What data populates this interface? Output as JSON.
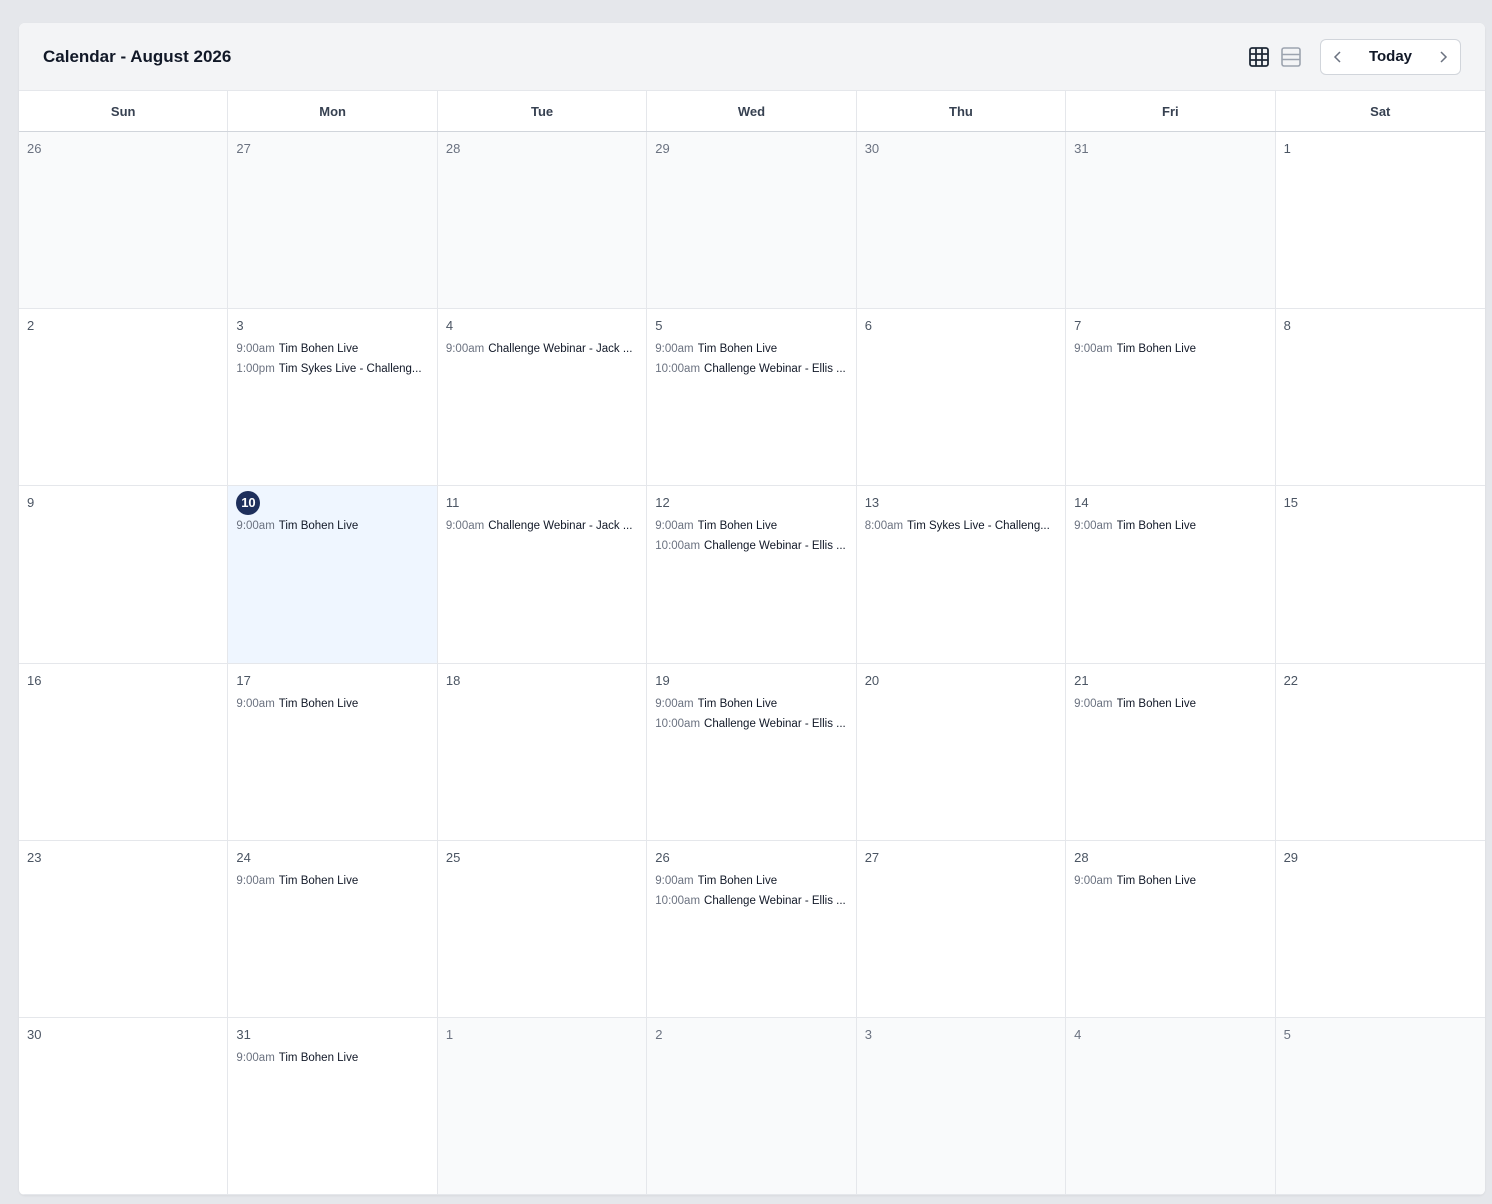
{
  "header": {
    "title": "Calendar - August 2026",
    "today_label": "Today",
    "views": [
      {
        "name": "month-grid-icon",
        "active": true
      },
      {
        "name": "list-view-icon",
        "active": false
      }
    ]
  },
  "colors": {
    "today_badge": "#1e2f5c",
    "today_bg": "#eff6ff",
    "outside_bg": "#f9fafb"
  },
  "weekdays": [
    "Sun",
    "Mon",
    "Tue",
    "Wed",
    "Thu",
    "Fri",
    "Sat"
  ],
  "days": [
    {
      "day": "26",
      "outside": true,
      "events": []
    },
    {
      "day": "27",
      "outside": true,
      "events": []
    },
    {
      "day": "28",
      "outside": true,
      "events": []
    },
    {
      "day": "29",
      "outside": true,
      "events": []
    },
    {
      "day": "30",
      "outside": true,
      "events": []
    },
    {
      "day": "31",
      "outside": true,
      "events": []
    },
    {
      "day": "1",
      "events": []
    },
    {
      "day": "2",
      "events": []
    },
    {
      "day": "3",
      "events": [
        {
          "time": "9:00am",
          "title": "Tim Bohen Live"
        },
        {
          "time": "1:00pm",
          "title": "Tim Sykes Live - Challeng..."
        }
      ]
    },
    {
      "day": "4",
      "events": [
        {
          "time": "9:00am",
          "title": "Challenge Webinar - Jack ..."
        }
      ]
    },
    {
      "day": "5",
      "events": [
        {
          "time": "9:00am",
          "title": "Tim Bohen Live"
        },
        {
          "time": "10:00am",
          "title": "Challenge Webinar - Ellis ..."
        }
      ]
    },
    {
      "day": "6",
      "events": []
    },
    {
      "day": "7",
      "events": [
        {
          "time": "9:00am",
          "title": "Tim Bohen Live"
        }
      ]
    },
    {
      "day": "8",
      "events": []
    },
    {
      "day": "9",
      "events": []
    },
    {
      "day": "10",
      "today": true,
      "events": [
        {
          "time": "9:00am",
          "title": "Tim Bohen Live"
        }
      ]
    },
    {
      "day": "11",
      "events": [
        {
          "time": "9:00am",
          "title": "Challenge Webinar - Jack ..."
        }
      ]
    },
    {
      "day": "12",
      "events": [
        {
          "time": "9:00am",
          "title": "Tim Bohen Live"
        },
        {
          "time": "10:00am",
          "title": "Challenge Webinar - Ellis ..."
        }
      ]
    },
    {
      "day": "13",
      "events": [
        {
          "time": "8:00am",
          "title": "Tim Sykes Live - Challeng..."
        }
      ]
    },
    {
      "day": "14",
      "events": [
        {
          "time": "9:00am",
          "title": "Tim Bohen Live"
        }
      ]
    },
    {
      "day": "15",
      "events": []
    },
    {
      "day": "16",
      "events": []
    },
    {
      "day": "17",
      "events": [
        {
          "time": "9:00am",
          "title": "Tim Bohen Live"
        }
      ]
    },
    {
      "day": "18",
      "events": []
    },
    {
      "day": "19",
      "events": [
        {
          "time": "9:00am",
          "title": "Tim Bohen Live"
        },
        {
          "time": "10:00am",
          "title": "Challenge Webinar - Ellis ..."
        }
      ]
    },
    {
      "day": "20",
      "events": []
    },
    {
      "day": "21",
      "events": [
        {
          "time": "9:00am",
          "title": "Tim Bohen Live"
        }
      ]
    },
    {
      "day": "22",
      "events": []
    },
    {
      "day": "23",
      "events": []
    },
    {
      "day": "24",
      "events": [
        {
          "time": "9:00am",
          "title": "Tim Bohen Live"
        }
      ]
    },
    {
      "day": "25",
      "events": []
    },
    {
      "day": "26",
      "events": [
        {
          "time": "9:00am",
          "title": "Tim Bohen Live"
        },
        {
          "time": "10:00am",
          "title": "Challenge Webinar - Ellis ..."
        }
      ]
    },
    {
      "day": "27",
      "events": []
    },
    {
      "day": "28",
      "events": [
        {
          "time": "9:00am",
          "title": "Tim Bohen Live"
        }
      ]
    },
    {
      "day": "29",
      "events": []
    },
    {
      "day": "30",
      "events": []
    },
    {
      "day": "31",
      "events": [
        {
          "time": "9:00am",
          "title": "Tim Bohen Live"
        }
      ]
    },
    {
      "day": "1",
      "outside": true,
      "events": []
    },
    {
      "day": "2",
      "outside": true,
      "events": []
    },
    {
      "day": "3",
      "outside": true,
      "events": []
    },
    {
      "day": "4",
      "outside": true,
      "events": []
    },
    {
      "day": "5",
      "outside": true,
      "events": []
    }
  ]
}
